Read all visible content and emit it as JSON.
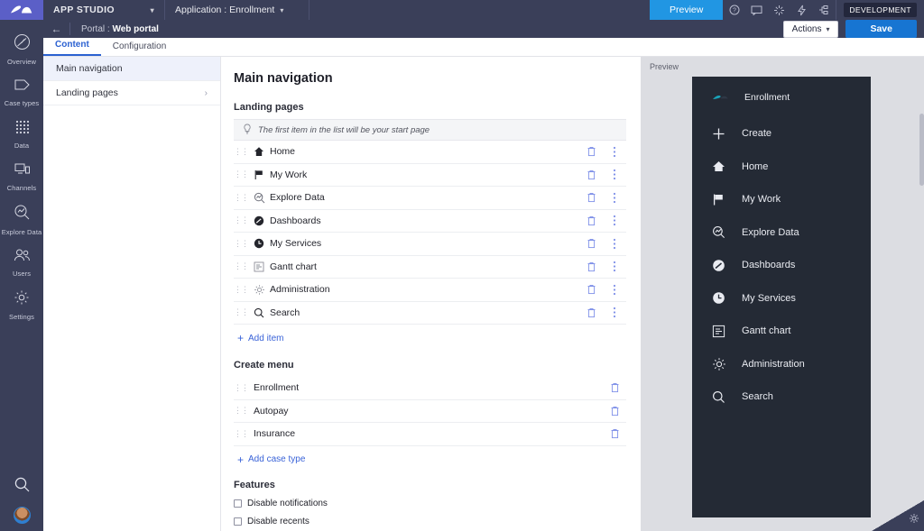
{
  "topbar": {
    "logo": "pega-logo-icon",
    "app_studio_label": "APP STUDIO",
    "application_label": "Application : Enrollment",
    "preview_label": "Preview",
    "icons": [
      "help-icon",
      "chat-icon",
      "sparkle-icon",
      "lightning-icon",
      "flow-node-icon"
    ],
    "environment_badge": "DEVELOPMENT"
  },
  "subbar": {
    "back_icon": "back-arrow-icon",
    "breadcrumb_prefix": "Portal :",
    "breadcrumb_value": "Web portal",
    "actions_label": "Actions",
    "save_label": "Save"
  },
  "rail": {
    "items": [
      {
        "label": "Overview",
        "icon": "overview-icon"
      },
      {
        "label": "Case types",
        "icon": "case-types-icon"
      },
      {
        "label": "Data",
        "icon": "data-grid-icon"
      },
      {
        "label": "Channels",
        "icon": "channels-icon"
      },
      {
        "label": "Explore Data",
        "icon": "explore-data-icon"
      },
      {
        "label": "Users",
        "icon": "users-icon"
      },
      {
        "label": "Settings",
        "icon": "settings-gear-icon"
      }
    ],
    "search_icon": "search-icon",
    "avatar": "user-avatar"
  },
  "tabs": [
    {
      "label": "Content",
      "active": true
    },
    {
      "label": "Configuration",
      "active": false
    }
  ],
  "list_panel": {
    "items": [
      {
        "label": "Main navigation",
        "active": true,
        "chevron": false
      },
      {
        "label": "Landing pages",
        "active": false,
        "chevron": true
      }
    ]
  },
  "main": {
    "title": "Main navigation",
    "landing_pages": {
      "section_label": "Landing pages",
      "hint_icon": "lightbulb-icon",
      "hint_text": "The first item in the list will be your start page",
      "rows": [
        {
          "label": "Home",
          "icon": "home-icon"
        },
        {
          "label": "My Work",
          "icon": "flag-icon"
        },
        {
          "label": "Explore Data",
          "icon": "explore-data-icon"
        },
        {
          "label": "Dashboards",
          "icon": "dashboard-icon"
        },
        {
          "label": "My Services",
          "icon": "clock-icon"
        },
        {
          "label": "Gantt chart",
          "icon": "gantt-chart-icon"
        },
        {
          "label": "Administration",
          "icon": "settings-gear-icon"
        },
        {
          "label": "Search",
          "icon": "search-icon"
        }
      ],
      "delete_icon": "trash-icon",
      "more_icon": "more-vertical-icon",
      "add_item_label": "Add item"
    },
    "create_menu": {
      "section_label": "Create menu",
      "rows": [
        {
          "label": "Enrollment"
        },
        {
          "label": "Autopay"
        },
        {
          "label": "Insurance"
        }
      ],
      "delete_icon": "trash-icon",
      "add_case_type_label": "Add case type"
    },
    "features": {
      "section_label": "Features",
      "checkboxes": [
        {
          "label": "Disable notifications",
          "checked": false
        },
        {
          "label": "Disable recents",
          "checked": false
        }
      ]
    }
  },
  "preview": {
    "label": "Preview",
    "app_name": "Enrollment",
    "items": [
      {
        "label": "Create",
        "icon": "plus-icon"
      },
      {
        "label": "Home",
        "icon": "home-icon"
      },
      {
        "label": "My Work",
        "icon": "flag-icon"
      },
      {
        "label": "Explore Data",
        "icon": "explore-data-icon"
      },
      {
        "label": "Dashboards",
        "icon": "dashboard-icon"
      },
      {
        "label": "My Services",
        "icon": "clock-icon"
      },
      {
        "label": "Gantt chart",
        "icon": "gantt-chart-icon"
      },
      {
        "label": "Administration",
        "icon": "settings-gear-icon"
      },
      {
        "label": "Search",
        "icon": "search-icon"
      }
    ]
  },
  "colors": {
    "brand_purple": "#5b5fc7",
    "dark_navy": "#3a3f59",
    "accent_blue": "#1775d2",
    "preview_blue": "#2196e3",
    "link_blue": "#3a63d8",
    "device_dark": "#242a35"
  }
}
